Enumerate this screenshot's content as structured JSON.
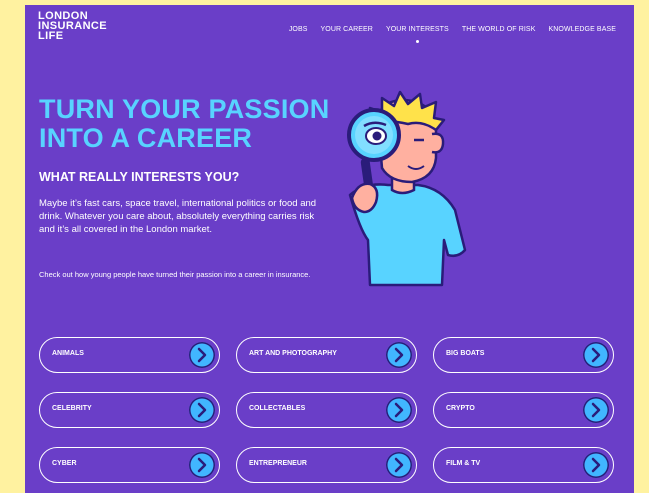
{
  "site": {
    "logo_lines": [
      "LONDON",
      "INSURANCE",
      "LIFE"
    ]
  },
  "nav": {
    "items": [
      {
        "label": "JOBS"
      },
      {
        "label": "YOUR CAREER"
      },
      {
        "label": "YOUR INTERESTS",
        "active": true
      },
      {
        "label": "THE WORLD OF RISK"
      },
      {
        "label": "KNOWLEDGE BASE"
      }
    ]
  },
  "hero": {
    "title_lines": [
      "TURN YOUR PASSION",
      "INTO A CAREER"
    ],
    "subheading": "WHAT REALLY INTERESTS YOU?",
    "intro": "Maybe it’s fast cars, space travel, international politics or food and drink. Whatever you care about, absolutely everything carries risk and it’s all covered in the London market.",
    "intro_small": "Check out how young people have turned their passion into a career in insurance.",
    "illustration": "person-with-magnifying-glass-illustration"
  },
  "interests": [
    {
      "label": "ANIMALS"
    },
    {
      "label": "ART AND PHOTOGRAPHY"
    },
    {
      "label": "BIG BOATS"
    },
    {
      "label": "CELEBRITY"
    },
    {
      "label": "COLLECTABLES"
    },
    {
      "label": "CRYPTO"
    },
    {
      "label": "CYBER"
    },
    {
      "label": "ENTREPRENEUR"
    },
    {
      "label": "FILM & TV"
    }
  ],
  "colors": {
    "background": "#6a3ec8",
    "accent": "#58d3ff",
    "arrow_button": "#41b6ff",
    "outer": "#fff2a0"
  }
}
